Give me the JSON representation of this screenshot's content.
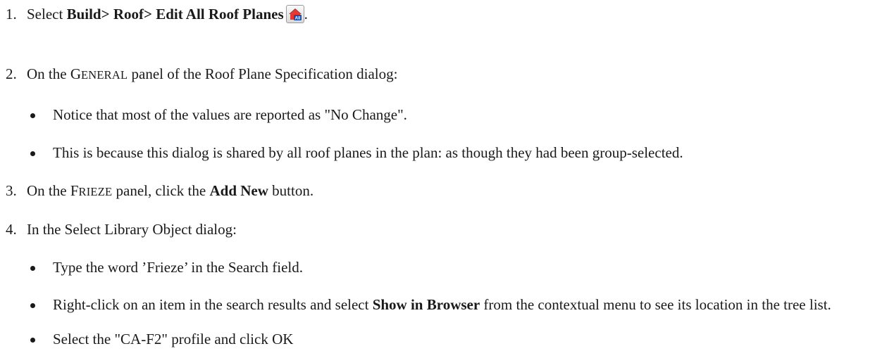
{
  "steps": [
    {
      "number": "1.",
      "text_pre": "Select ",
      "menu_path": "Build> Roof> Edit All Roof Planes",
      "text_post": ".",
      "icon": "edit-all-roof-planes-icon"
    },
    {
      "number": "2.",
      "text_pre": "On the ",
      "panel_cap": "G",
      "panel_rest": "ENERAL",
      "text_post": " panel of the Roof Plane Specification dialog:",
      "bullets": [
        "Notice that most of the values are reported as \"No Change\".",
        "This is because this dialog is shared by all roof planes in the plan: as though they had been group-selected."
      ]
    },
    {
      "number": "3.",
      "text_pre": "On the ",
      "panel_cap": "F",
      "panel_rest": "RIEZE",
      "text_mid": " panel, click the ",
      "button_name": "Add New",
      "text_post": " button."
    },
    {
      "number": "4.",
      "text": "In the Select Library Object dialog:",
      "bullets": [
        {
          "text": "Type the word ’Frieze’ in the Search field."
        },
        {
          "pre": "Right-click on an item in the search results and select ",
          "bold": "Show in Browser",
          "post": " from the contextual menu to see its location in the tree list."
        },
        {
          "text": "Select the \"CA-F2\" profile and click OK"
        }
      ]
    }
  ],
  "colors": {
    "text": "#1a1a1a",
    "icon_roof": "#c62828",
    "icon_label_bg": "#1e4fa8"
  },
  "icon_label": "All"
}
